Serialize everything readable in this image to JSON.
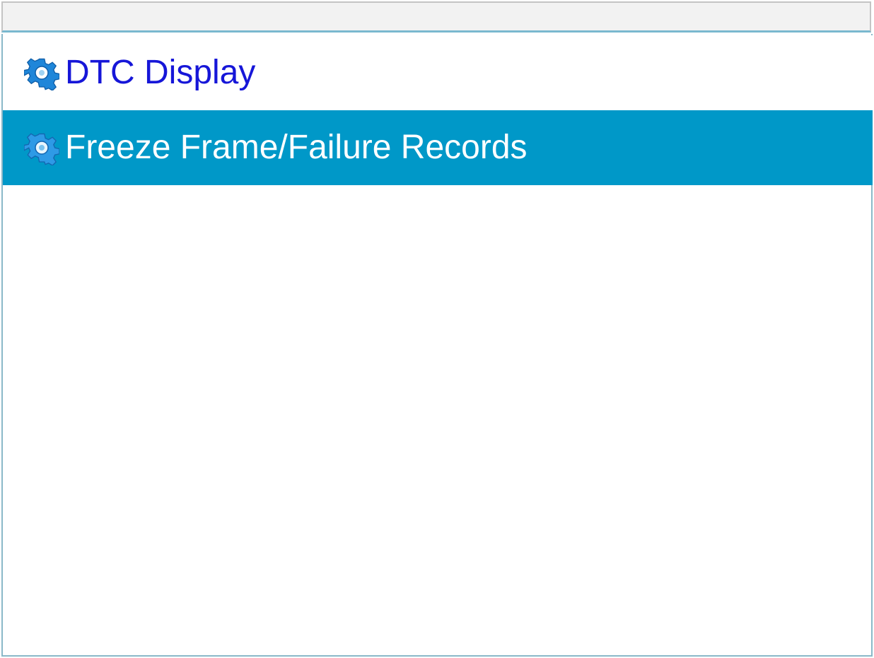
{
  "colors": {
    "normal_text": "#1616d8",
    "selected_bg": "#0098c8",
    "selected_text": "#ffffff",
    "gear_icon": "#1f86d9"
  },
  "menu": {
    "items": [
      {
        "label": "DTC Display",
        "icon": "gear-icon",
        "selected": false
      },
      {
        "label": "Freeze Frame/Failure Records",
        "icon": "gear-icon",
        "selected": true
      }
    ]
  }
}
